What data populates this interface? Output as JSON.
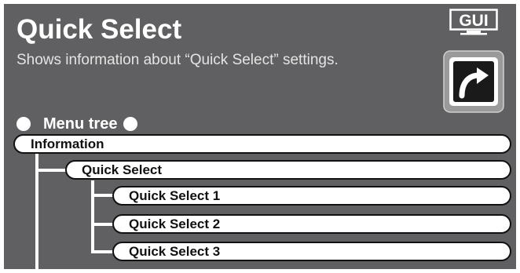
{
  "header": {
    "title": "Quick Select",
    "description": "Shows information about “Quick Select” settings.",
    "gui_badge": "GUI",
    "link_icon": "arrow-jump-icon"
  },
  "menu_tree": {
    "heading": "Menu tree",
    "items": [
      {
        "label": "Information",
        "level": 0
      },
      {
        "label": "Quick Select",
        "level": 1
      },
      {
        "label": "Quick Select 1",
        "level": 2
      },
      {
        "label": "Quick Select 2",
        "level": 2
      },
      {
        "label": "Quick Select 3",
        "level": 2
      }
    ]
  },
  "colors": {
    "panel_bg": "#606062",
    "text": "#ffffff",
    "pill_bg": "#ffffff",
    "pill_border": "#111111"
  }
}
